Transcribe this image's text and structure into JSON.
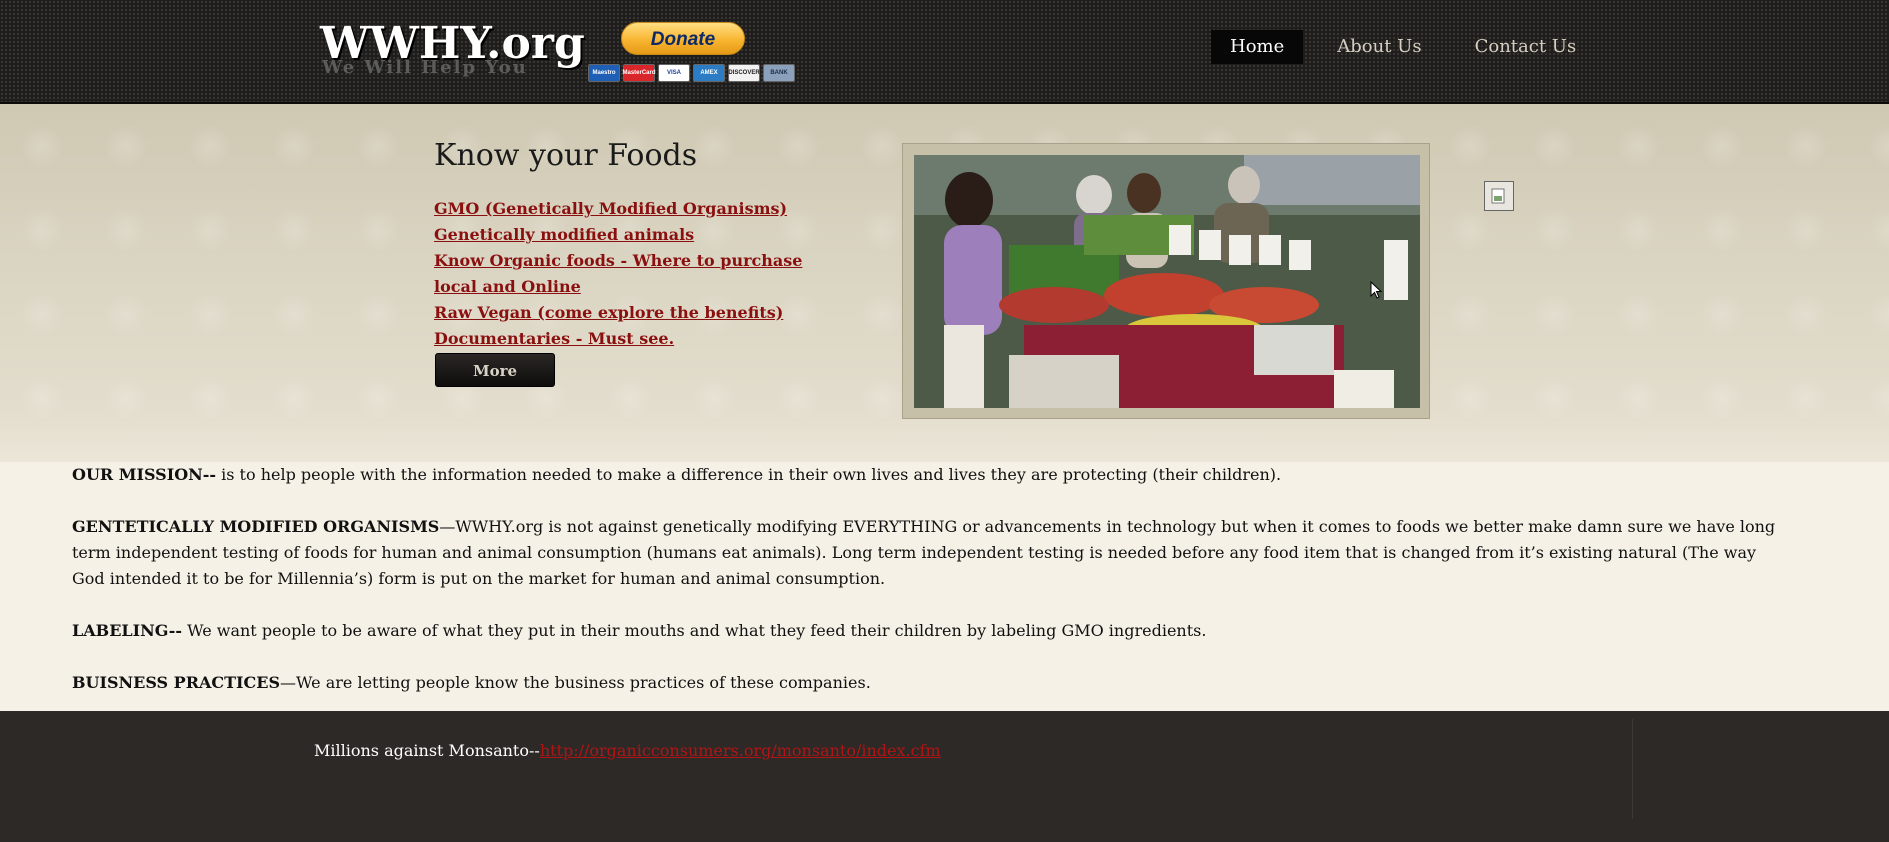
{
  "header": {
    "logo_text": "WWHY.org",
    "tagline": "We Will Help You",
    "donate_label": "Donate",
    "cards": [
      {
        "label": "Maestro",
        "color": "#1f5fb5"
      },
      {
        "label": "MasterCard",
        "color": "#d8262a"
      },
      {
        "label": "VISA",
        "color": "#ffffff"
      },
      {
        "label": "AMEX",
        "color": "#2b7bc5"
      },
      {
        "label": "DISCOVER",
        "color": "#f2f2f2"
      },
      {
        "label": "BANK",
        "color": "#8aa0bb"
      }
    ],
    "nav": [
      {
        "label": "Home",
        "active": true
      },
      {
        "label": "About Us",
        "active": false
      },
      {
        "label": "Contact Us",
        "active": false
      }
    ]
  },
  "hero": {
    "title": "Know your Foods",
    "links": [
      "GMO (Genetically Modified Organisms)",
      "Genetically modified animals",
      "Know Organic foods - Where to purchase local and Online",
      "Raw Vegan (come explore the benefits)",
      "Documentaries - Must see."
    ],
    "more_label": "More",
    "photo_icon": "farmers-market-photo"
  },
  "content": {
    "mission_label": "OUR MISSION--",
    "mission_text": " is to help people with the information needed to make a difference in their own lives and lives they are protecting (their children).",
    "gmo_label": "GENTETICALLY MODIFIED ORGANISMS",
    "gmo_text": "—WWHY.org is not against genetically modifying EVERYTHING or advancements in technology but when it comes to foods we better make damn sure we have long term independent testing of foods for human and animal consumption (humans eat animals). Long term independent testing is needed before any food item that is changed from it’s existing natural (The way God intended it to be for Millennia’s) form is put on the market for human and animal consumption.",
    "labeling_label": "LABELING--",
    "labeling_text": " We want people to be aware of what they put in their mouths and what they feed their children by labeling GMO ingredients.",
    "business_label": "BUISNESS PRACTICES",
    "business_text": "—We are letting people know the business practices of these companies."
  },
  "footer": {
    "text": "Millions against Monsanto--",
    "link": "http://organicconsumers.org/monsanto/index.cfm"
  },
  "colors": {
    "header_bg": "#1e1d1c",
    "link_red": "#8a1010",
    "content_bg": "#f5f1e6",
    "footer_bg": "#2d2927"
  }
}
